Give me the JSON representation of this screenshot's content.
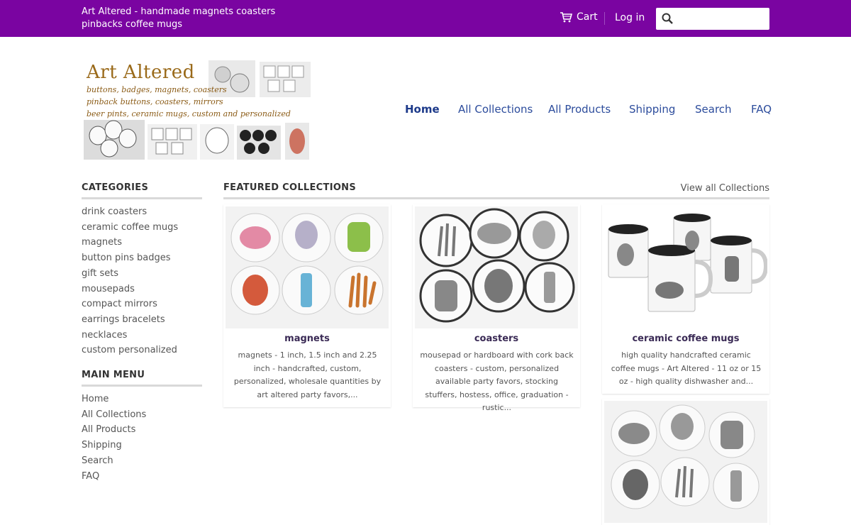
{
  "header": {
    "site_title": "Art Altered - handmade magnets coasters pinbacks coffee mugs",
    "cart_label": "Cart",
    "login_label": "Log in",
    "search_value": "",
    "search_placeholder": ""
  },
  "logo": {
    "title": "Art Altered",
    "lines": [
      "buttons, badges, magnets, coasters",
      "pinback buttons, coasters, mirrors",
      "beer pints, ceramic mugs, custom and personalized"
    ]
  },
  "nav": {
    "items": [
      "Home",
      "All Collections",
      "All Products",
      "Shipping",
      "Search",
      "FAQ"
    ],
    "active": "Home"
  },
  "sidebar": {
    "categories_heading": "CATEGORIES",
    "categories": [
      "drink coasters",
      "ceramic coffee mugs",
      "magnets",
      "button pins badges",
      "gift sets",
      "mousepads",
      "compact mirrors",
      "earrings bracelets necklaces",
      "custom personalized"
    ],
    "menu_heading": "MAIN MENU",
    "menu": [
      "Home",
      "All Collections",
      "All Products",
      "Shipping",
      "Search",
      "FAQ"
    ]
  },
  "featured": {
    "heading": "FEATURED COLLECTIONS",
    "view_all": "View all Collections",
    "collections": [
      {
        "title": "magnets",
        "description": "magnets - 1 inch, 1.5 inch and 2.25 inch - handcrafted, custom, personalized, wholesale quantities by art altered party favors,..."
      },
      {
        "title": "coasters",
        "description": "mousepad or hardboard with cork back coasters - custom, personalized available party favors, stocking stuffers, hostess, office, graduation - rustic..."
      },
      {
        "title": "ceramic coffee mugs",
        "description": "high quality handcrafted ceramic coffee mugs - Art Altered - 11 oz or 15 oz - high quality dishwasher and..."
      }
    ]
  },
  "colors": {
    "topbar": "#7a04a1",
    "nav_link": "#2c4c9c",
    "logo_text": "#9a6a1a"
  }
}
